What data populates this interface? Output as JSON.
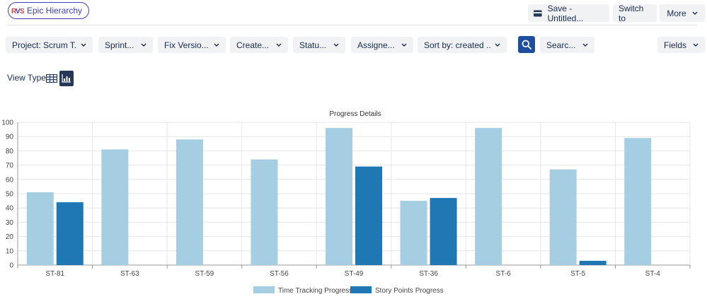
{
  "header": {
    "app_name": "Epic Hierarchy",
    "save_label": "Save - Untitled...",
    "switch_label": "Switch to",
    "more_label": "More"
  },
  "filters": [
    {
      "label": "Project: Scrum T...",
      "x": 0
    },
    {
      "label": "Sprint...",
      "x": 0
    },
    {
      "label": "Fix Versio...",
      "x": 0
    },
    {
      "label": "Create...",
      "x": 0
    },
    {
      "label": "Statu...",
      "x": 0
    },
    {
      "label": "Assigne...",
      "x": 0
    },
    {
      "label": "Sort by: created ...",
      "x": 0
    },
    {
      "label": "Searc...",
      "x": 0
    },
    {
      "label": "Fields",
      "x": 0
    }
  ],
  "view_type": {
    "label": "View Type",
    "selected": "chart"
  },
  "colors": {
    "brand": "#3d3fb6",
    "time_tracking": "#a6cee3",
    "story_points": "#1f78b4",
    "search_button": "#1f4f9c"
  },
  "chart_data": {
    "type": "bar",
    "title": "Progress Details",
    "categories": [
      "ST-81",
      "ST-63",
      "ST-59",
      "ST-56",
      "ST-49",
      "ST-36",
      "ST-6",
      "ST-5",
      "ST-4"
    ],
    "series": [
      {
        "name": "Time Tracking Progress",
        "color": "#a6cee3",
        "values": [
          51,
          81,
          88,
          74,
          96,
          45,
          96,
          67,
          89
        ]
      },
      {
        "name": "Story Points Progress",
        "color": "#1f78b4",
        "values": [
          44,
          0,
          0,
          0,
          69,
          47,
          0,
          3,
          0
        ]
      }
    ],
    "yticks": [
      "0",
      "10",
      "20",
      "30",
      "40",
      "50",
      "60",
      "70",
      "80",
      "90",
      "100"
    ],
    "ylim": [
      0,
      100
    ],
    "grid": true,
    "legend_position": "bottom"
  }
}
